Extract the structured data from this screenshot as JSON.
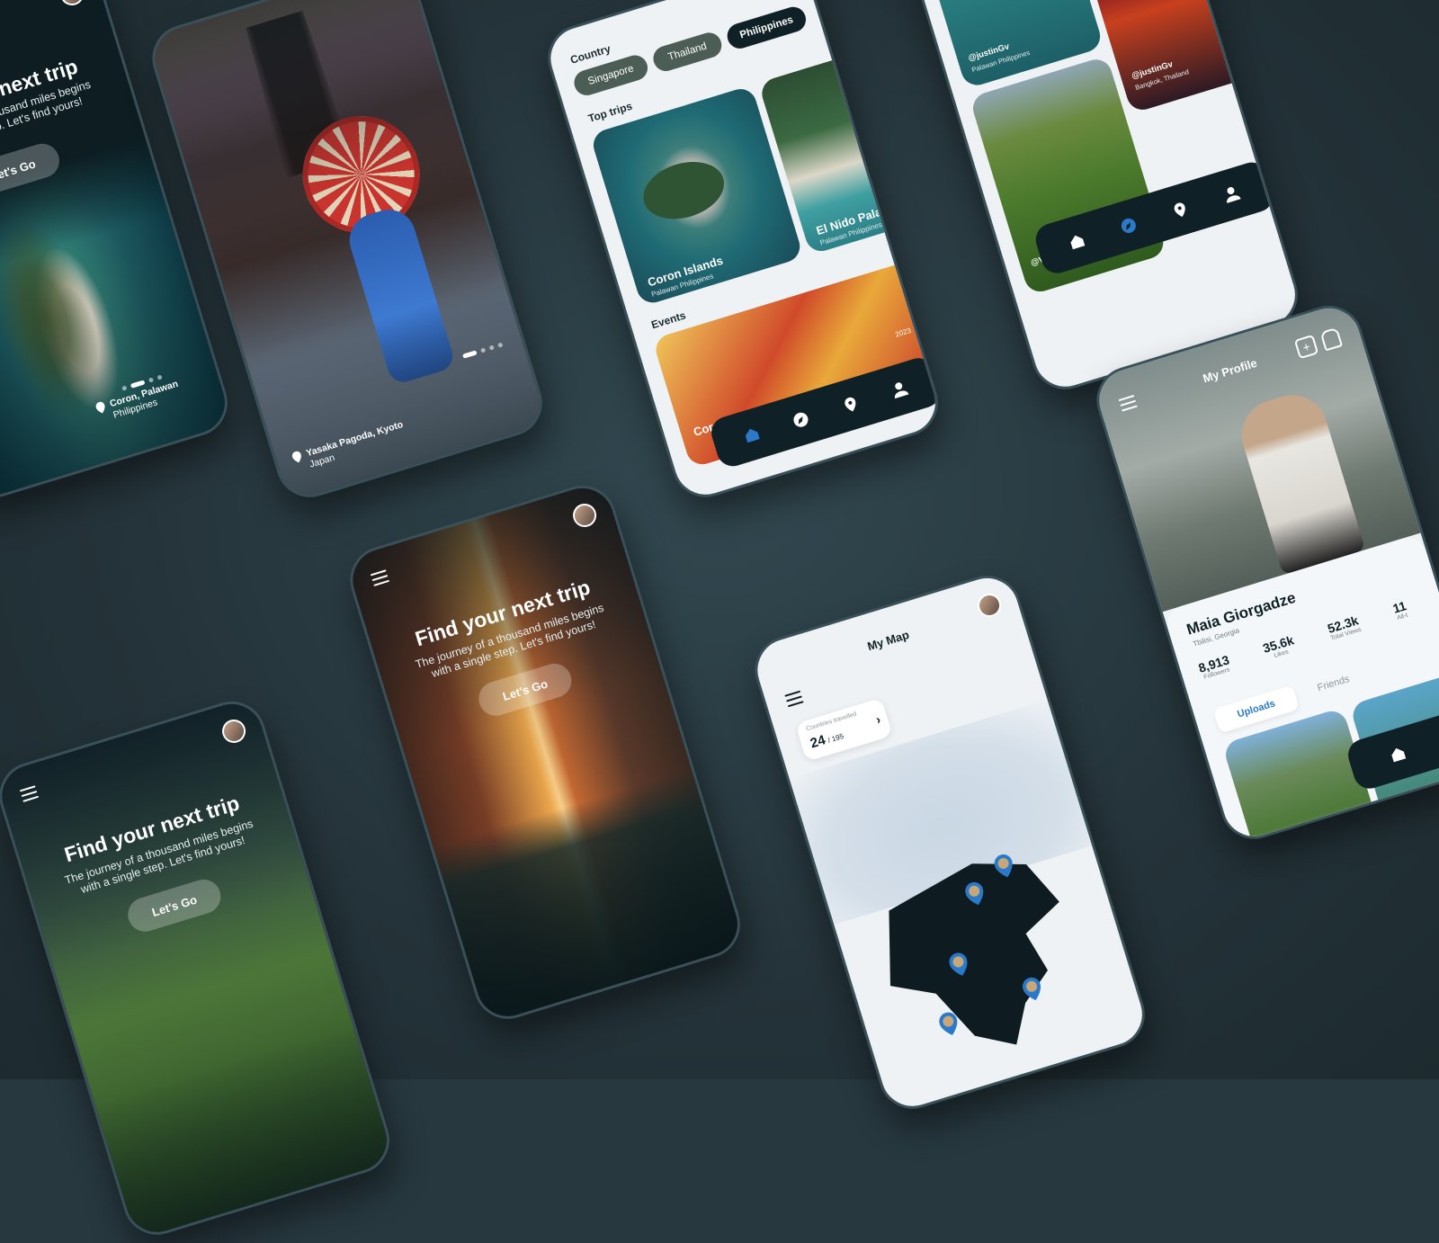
{
  "colors": {
    "background": "#27383f",
    "dark": "#0f2127",
    "accent": "#2a7ac9",
    "light": "#eef2f5"
  },
  "onboarding_coron": {
    "title": "Find your next trip",
    "subtitle": "The journey of a thousand miles begins with a single step. Let's find yours!",
    "button": "Let's Go",
    "location_line1": "Coron, Palawan",
    "location_line2": "Philippines"
  },
  "kyoto": {
    "location_line1": "Yasaka Pagoda, Kyoto",
    "location_line2": "Japan"
  },
  "explore": {
    "country_label": "Country",
    "countries": [
      "Singapore",
      "Thailand",
      "Philippines"
    ],
    "top_trips_label": "Top trips",
    "trips": [
      {
        "name": "Coron Islands",
        "place": "Palawan Philippines"
      },
      {
        "name": "El Nido Palawan",
        "place": "Palawan Philippines"
      }
    ],
    "events_label": "Events",
    "event": {
      "name": "Coron Islands",
      "date": "2023"
    }
  },
  "feed": {
    "posts": [
      {
        "handle": "@justinGv",
        "place": "Palawan Philippines"
      },
      {
        "handle": "@justinGv",
        "place": "Bangkok, Thailand"
      },
      {
        "handle": "@VerJacobs",
        "place": ""
      }
    ]
  },
  "profile": {
    "title": "My Profile",
    "name": "Maia Giorgadze",
    "location": "Tbilisi, Georgia",
    "stats": [
      {
        "value": "8,913",
        "label": "Followers"
      },
      {
        "value": "35.6k",
        "label": "Likes"
      },
      {
        "value": "52.3k",
        "label": "Total Views"
      },
      {
        "value": "11",
        "label": "All-t"
      }
    ],
    "tabs": [
      "Uploads",
      "Friends"
    ]
  },
  "onboarding_valley": {
    "title": "Find your next trip",
    "subtitle": "The journey of a thousand miles begins with a single step. Let's find yours!",
    "button": "Let's Go"
  },
  "onboarding_venice": {
    "title": "Find your next trip",
    "subtitle": "The journey of a thousand miles begins with a single step. Let's find yours!",
    "button": "Let's Go"
  },
  "map": {
    "title": "My Map",
    "countries_label": "Countries travelled",
    "count": "24",
    "total": "/ 195"
  }
}
